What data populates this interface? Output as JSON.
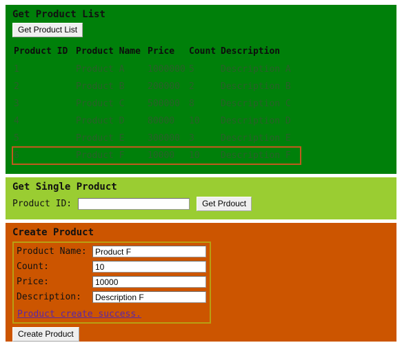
{
  "product_list": {
    "heading": "Get Product List",
    "button_label": "Get Product List",
    "columns": [
      "Product ID",
      "Product Name",
      "Price",
      "Count",
      "Description"
    ],
    "rows": [
      {
        "id": "1",
        "name": "Product A",
        "price": "1000000",
        "count": "5",
        "description": "Description A",
        "highlighted": false
      },
      {
        "id": "2",
        "name": "Product B",
        "price": "200000",
        "count": "2",
        "description": "Description B",
        "highlighted": false
      },
      {
        "id": "3",
        "name": "Product C",
        "price": "500000",
        "count": "8",
        "description": "Description C",
        "highlighted": false
      },
      {
        "id": "4",
        "name": "Product D",
        "price": "80000",
        "count": "10",
        "description": "Description D",
        "highlighted": false
      },
      {
        "id": "5",
        "name": "Product E",
        "price": "300000",
        "count": "3",
        "description": "Description E",
        "highlighted": false
      },
      {
        "id": "6",
        "name": "Product F",
        "price": "10000",
        "count": "10",
        "description": "Description F",
        "highlighted": true
      }
    ],
    "background_color": "#00800a",
    "highlight_color": "#c05a1e"
  },
  "single_product": {
    "heading": "Get Single Product",
    "id_label": "Product ID:",
    "id_value": "",
    "button_label": "Get Prdouct",
    "background_color": "#9acd32"
  },
  "create_product": {
    "heading": "Create Product",
    "fields": [
      {
        "label": "Product Name:",
        "value": "Product F"
      },
      {
        "label": "Count:",
        "value": "10"
      },
      {
        "label": "Price:",
        "value": "10000"
      },
      {
        "label": "Description:",
        "value": "Description F"
      }
    ],
    "status_message": "Product create success.",
    "status_color": "#5b26a8",
    "button_label": "Create Product",
    "background_color": "#cc5500",
    "box_border_color": "#b8a013"
  }
}
